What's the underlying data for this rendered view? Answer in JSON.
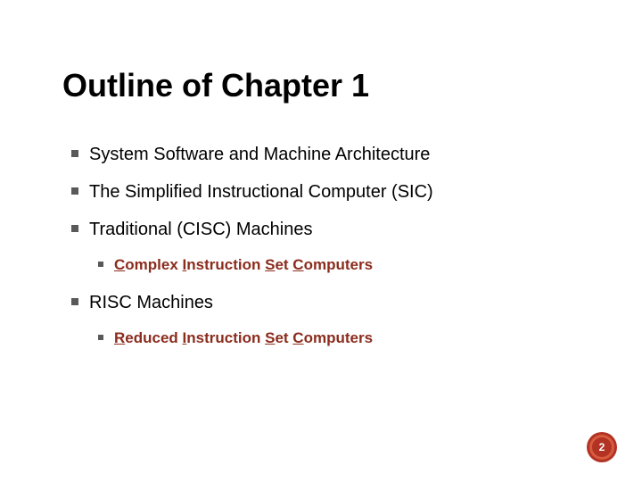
{
  "title": "Outline of Chapter 1",
  "items": [
    {
      "text": "System Software and Machine Architecture"
    },
    {
      "text": "The Simplified Instructional Computer (SIC)"
    },
    {
      "text": "Traditional (CISC) Machines",
      "sub": {
        "parts": [
          {
            "t": "C",
            "u": true
          },
          {
            "t": "omplex "
          },
          {
            "t": "I",
            "u": true
          },
          {
            "t": "nstruction "
          },
          {
            "t": "S",
            "u": true
          },
          {
            "t": "et "
          },
          {
            "t": "C",
            "u": true
          },
          {
            "t": "omputers"
          }
        ]
      }
    },
    {
      "text": "RISC Machines",
      "sub": {
        "parts": [
          {
            "t": "R",
            "u": true
          },
          {
            "t": "educed "
          },
          {
            "t": "I",
            "u": true
          },
          {
            "t": "nstruction "
          },
          {
            "t": "S",
            "u": true
          },
          {
            "t": "et "
          },
          {
            "t": "C",
            "u": true
          },
          {
            "t": "omputers"
          }
        ]
      }
    }
  ],
  "page_number": "2",
  "colors": {
    "accent": "#8b2c1d",
    "bullet": "#595959",
    "badge_outer": "#b23323",
    "badge_mid": "#d85b3f"
  }
}
